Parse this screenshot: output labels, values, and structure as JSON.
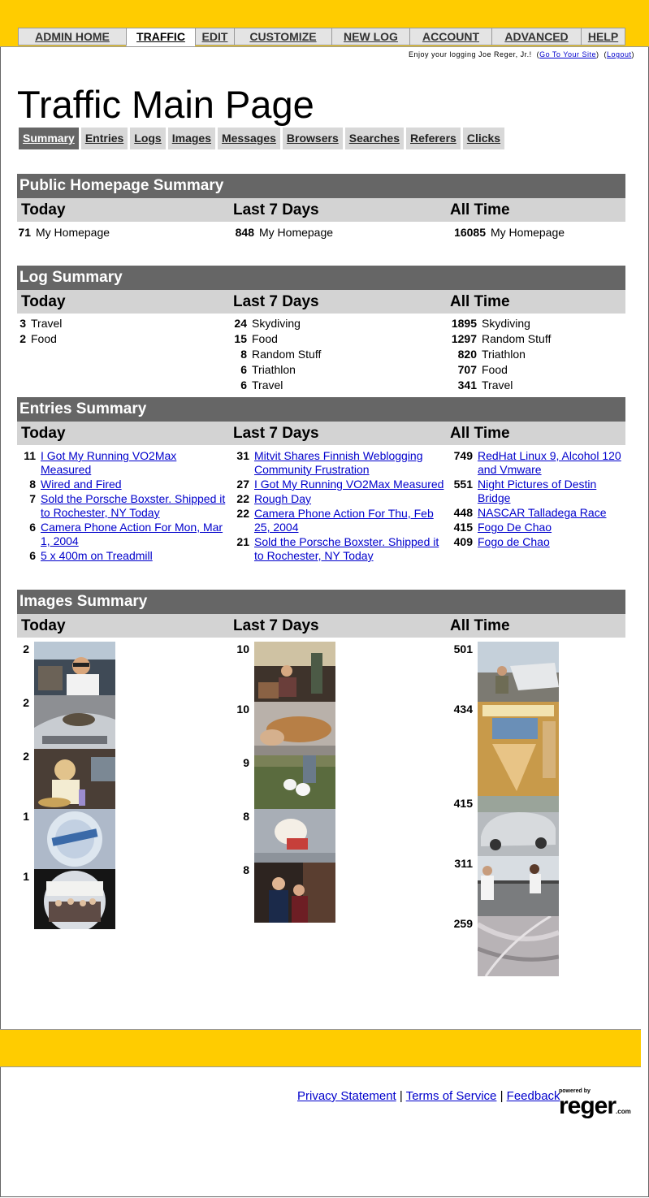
{
  "nav": {
    "tabs": [
      "ADMIN HOME",
      "TRAFFIC",
      "EDIT",
      "CUSTOMIZE",
      "NEW LOG",
      "ACCOUNT",
      "ADVANCED",
      "HELP"
    ],
    "active": "TRAFFIC"
  },
  "user": {
    "greeting": "Enjoy your logging Joe Reger, Jr.!",
    "site_link": "Go To Your Site",
    "logout_link": "Logout"
  },
  "page": {
    "title": "Traffic Main Page"
  },
  "subnav": {
    "tabs": [
      "Summary",
      "Entries",
      "Logs",
      "Images",
      "Messages",
      "Browsers",
      "Searches",
      "Referers",
      "Clicks"
    ],
    "active": "Summary"
  },
  "columns": {
    "today": "Today",
    "week": "Last 7 Days",
    "all": "All Time"
  },
  "homepage": {
    "title": "Public Homepage Summary",
    "today": [
      {
        "n": "71",
        "label": "My Homepage"
      }
    ],
    "week": [
      {
        "n": "848",
        "label": "My Homepage"
      }
    ],
    "all": [
      {
        "n": "16085",
        "label": "My Homepage"
      }
    ]
  },
  "logs": {
    "title": "Log Summary",
    "today": [
      {
        "n": "3",
        "label": "Travel"
      },
      {
        "n": "2",
        "label": "Food"
      }
    ],
    "week": [
      {
        "n": "24",
        "label": "Skydiving"
      },
      {
        "n": "15",
        "label": "Food"
      },
      {
        "n": "8",
        "label": "Random Stuff"
      },
      {
        "n": "6",
        "label": "Triathlon"
      },
      {
        "n": "6",
        "label": "Travel"
      }
    ],
    "all": [
      {
        "n": "1895",
        "label": "Skydiving"
      },
      {
        "n": "1297",
        "label": "Random Stuff"
      },
      {
        "n": "820",
        "label": "Triathlon"
      },
      {
        "n": "707",
        "label": "Food"
      },
      {
        "n": "341",
        "label": "Travel"
      }
    ]
  },
  "entries": {
    "title": "Entries Summary",
    "today": [
      {
        "n": "11",
        "label": "I Got My Running VO2Max Measured"
      },
      {
        "n": "8",
        "label": "Wired and Fired"
      },
      {
        "n": "7",
        "label": "Sold the Porsche Boxster. Shipped it to Rochester, NY Today"
      },
      {
        "n": "6",
        "label": "Camera Phone Action For Mon, Mar 1, 2004"
      },
      {
        "n": "6",
        "label": "5 x 400m on Treadmill"
      }
    ],
    "week": [
      {
        "n": "31",
        "label": "Mitvit Shares Finnish Weblogging Community Frustration"
      },
      {
        "n": "27",
        "label": "I Got My Running VO2Max Measured"
      },
      {
        "n": "22",
        "label": "Rough Day"
      },
      {
        "n": "22",
        "label": "Camera Phone Action For Thu, Feb 25, 2004"
      },
      {
        "n": "21",
        "label": "Sold the Porsche Boxster. Shipped it to Rochester, NY Today"
      }
    ],
    "all": [
      {
        "n": "749",
        "label": "RedHat Linux 9, Alcohol 120 and Vmware"
      },
      {
        "n": "551",
        "label": "Night Pictures of Destin Bridge"
      },
      {
        "n": "448",
        "label": "NASCAR Talladega Race"
      },
      {
        "n": "415",
        "label": "Fogo De Chao"
      },
      {
        "n": "409",
        "label": "Fogo de Chao"
      }
    ]
  },
  "images": {
    "title": "Images Summary",
    "today": [
      "2",
      "2",
      "2",
      "1",
      "1"
    ],
    "week": [
      "10",
      "10",
      "9",
      "8",
      "8"
    ],
    "all": [
      "501",
      "434",
      "415",
      "311",
      "259"
    ]
  },
  "footer": {
    "privacy": "Privacy Statement",
    "terms": "Terms of Service",
    "feedback": "Feedback",
    "sep": "|",
    "powered_by": "powered by",
    "brand": "reger",
    "brand_suffix": ".com"
  }
}
